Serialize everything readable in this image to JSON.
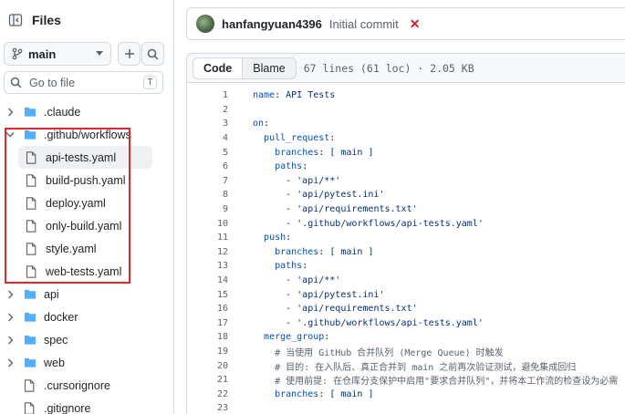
{
  "sidebar": {
    "title": "Files",
    "branch": "main",
    "goto": {
      "placeholder": "Go to file",
      "shortcut": "T"
    },
    "tree": [
      {
        "label": ".claude",
        "kind": "dir",
        "state": "collapsed"
      },
      {
        "label": ".github/workflows",
        "kind": "dir",
        "state": "expanded"
      },
      {
        "label": "api-tests.yaml",
        "kind": "file",
        "level": 1,
        "selected": true
      },
      {
        "label": "build-push.yaml",
        "kind": "file",
        "level": 1
      },
      {
        "label": "deploy.yaml",
        "kind": "file",
        "level": 1
      },
      {
        "label": "only-build.yaml",
        "kind": "file",
        "level": 1
      },
      {
        "label": "style.yaml",
        "kind": "file",
        "level": 1
      },
      {
        "label": "web-tests.yaml",
        "kind": "file",
        "level": 1
      },
      {
        "label": "api",
        "kind": "dir",
        "state": "collapsed"
      },
      {
        "label": "docker",
        "kind": "dir",
        "state": "collapsed"
      },
      {
        "label": "spec",
        "kind": "dir",
        "state": "collapsed"
      },
      {
        "label": "web",
        "kind": "dir",
        "state": "collapsed"
      },
      {
        "label": ".cursorignore",
        "kind": "file",
        "level": 0
      },
      {
        "label": ".gitignore",
        "kind": "file",
        "level": 0
      }
    ]
  },
  "commit": {
    "author": "hanfangyuan4396",
    "message": "Initial commit",
    "status_icon": "x-icon"
  },
  "file_view": {
    "tabs": [
      "Code",
      "Blame"
    ],
    "active_tab": "Code",
    "meta": "67 lines (61 loc) · 2.05 KB"
  },
  "code": [
    {
      "n": "1",
      "t": "name: API Tests"
    },
    {
      "n": "2",
      "t": ""
    },
    {
      "n": "3",
      "t": "on:"
    },
    {
      "n": "4",
      "t": "  pull_request:"
    },
    {
      "n": "5",
      "t": "    branches: [ main ]"
    },
    {
      "n": "6",
      "t": "    paths:"
    },
    {
      "n": "7",
      "t": "      - 'api/**'"
    },
    {
      "n": "8",
      "t": "      - 'api/pytest.ini'"
    },
    {
      "n": "9",
      "t": "      - 'api/requirements.txt'"
    },
    {
      "n": "10",
      "t": "      - '.github/workflows/api-tests.yaml'"
    },
    {
      "n": "11",
      "t": "  push:"
    },
    {
      "n": "12",
      "t": "    branches: [ main ]"
    },
    {
      "n": "13",
      "t": "    paths:"
    },
    {
      "n": "14",
      "t": "      - 'api/**'"
    },
    {
      "n": "15",
      "t": "      - 'api/pytest.ini'"
    },
    {
      "n": "16",
      "t": "      - 'api/requirements.txt'"
    },
    {
      "n": "17",
      "t": "      - '.github/workflows/api-tests.yaml'"
    },
    {
      "n": "18",
      "t": "  merge_group:"
    },
    {
      "n": "19",
      "t": "    # 当使用 GitHub 合并队列 (Merge Queue) 时触发"
    },
    {
      "n": "20",
      "t": "    # 目的: 在入队后、真正合并到 main 之前再次验证测试，避免集成回归"
    },
    {
      "n": "21",
      "t": "    # 使用前提: 在仓库分支保护中启用\"要求合并队列\"，并将本工作流的检查设为必需"
    },
    {
      "n": "22",
      "t": "    branches: [ main ]"
    },
    {
      "n": "23",
      "t": ""
    }
  ],
  "colors": {
    "highlight_box": "#e5262c",
    "folder": "#54aeff",
    "error_x": "#d1242f"
  }
}
